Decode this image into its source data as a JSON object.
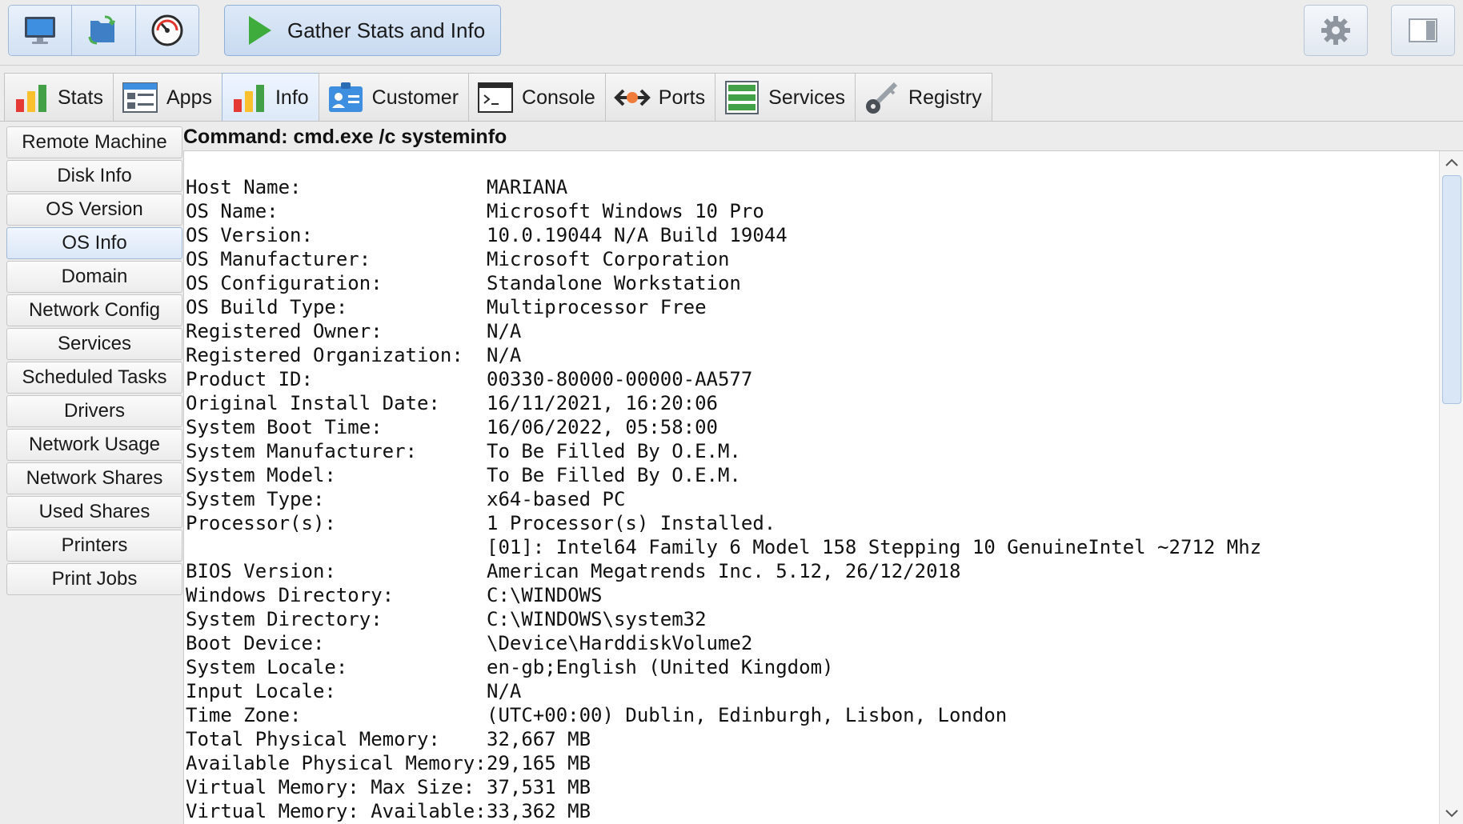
{
  "toolbar": {
    "gather_label": "Gather Stats and Info"
  },
  "tabs": [
    {
      "label": "Stats"
    },
    {
      "label": "Apps"
    },
    {
      "label": "Info"
    },
    {
      "label": "Customer"
    },
    {
      "label": "Console"
    },
    {
      "label": "Ports"
    },
    {
      "label": "Services"
    },
    {
      "label": "Registry"
    }
  ],
  "side": [
    {
      "label": "Remote Machine"
    },
    {
      "label": "Disk Info"
    },
    {
      "label": "OS Version"
    },
    {
      "label": "OS Info"
    },
    {
      "label": "Domain"
    },
    {
      "label": "Network Config"
    },
    {
      "label": "Services"
    },
    {
      "label": "Scheduled Tasks"
    },
    {
      "label": "Drivers"
    },
    {
      "label": "Network Usage"
    },
    {
      "label": "Network Shares"
    },
    {
      "label": "Used Shares"
    },
    {
      "label": "Printers"
    },
    {
      "label": "Print Jobs"
    }
  ],
  "command": "Command: cmd.exe /c systeminfo",
  "output": [
    {
      "k": "Host Name:",
      "v": "MARIANA"
    },
    {
      "k": "OS Name:",
      "v": "Microsoft Windows 10 Pro"
    },
    {
      "k": "OS Version:",
      "v": "10.0.19044 N/A Build 19044"
    },
    {
      "k": "OS Manufacturer:",
      "v": "Microsoft Corporation"
    },
    {
      "k": "OS Configuration:",
      "v": "Standalone Workstation"
    },
    {
      "k": "OS Build Type:",
      "v": "Multiprocessor Free"
    },
    {
      "k": "Registered Owner:",
      "v": "N/A"
    },
    {
      "k": "Registered Organization:",
      "v": "N/A"
    },
    {
      "k": "Product ID:",
      "v": "00330-80000-00000-AA577"
    },
    {
      "k": "Original Install Date:",
      "v": "16/11/2021, 16:20:06"
    },
    {
      "k": "System Boot Time:",
      "v": "16/06/2022, 05:58:00"
    },
    {
      "k": "System Manufacturer:",
      "v": "To Be Filled By O.E.M."
    },
    {
      "k": "System Model:",
      "v": "To Be Filled By O.E.M."
    },
    {
      "k": "System Type:",
      "v": "x64-based PC"
    },
    {
      "k": "Processor(s):",
      "v": "1 Processor(s) Installed."
    },
    {
      "k": "",
      "v": "[01]: Intel64 Family 6 Model 158 Stepping 10 GenuineIntel ~2712 Mhz"
    },
    {
      "k": "BIOS Version:",
      "v": "American Megatrends Inc. 5.12, 26/12/2018"
    },
    {
      "k": "Windows Directory:",
      "v": "C:\\WINDOWS"
    },
    {
      "k": "System Directory:",
      "v": "C:\\WINDOWS\\system32"
    },
    {
      "k": "Boot Device:",
      "v": "\\Device\\HarddiskVolume2"
    },
    {
      "k": "System Locale:",
      "v": "en-gb;English (United Kingdom)"
    },
    {
      "k": "Input Locale:",
      "v": "N/A"
    },
    {
      "k": "Time Zone:",
      "v": "(UTC+00:00) Dublin, Edinburgh, Lisbon, London"
    },
    {
      "k": "Total Physical Memory:",
      "v": "32,667 MB"
    },
    {
      "k": "Available Physical Memory:",
      "v": "29,165 MB"
    },
    {
      "k": "Virtual Memory: Max Size:",
      "v": "37,531 MB"
    },
    {
      "k": "Virtual Memory: Available:",
      "v": "33,362 MB"
    }
  ]
}
